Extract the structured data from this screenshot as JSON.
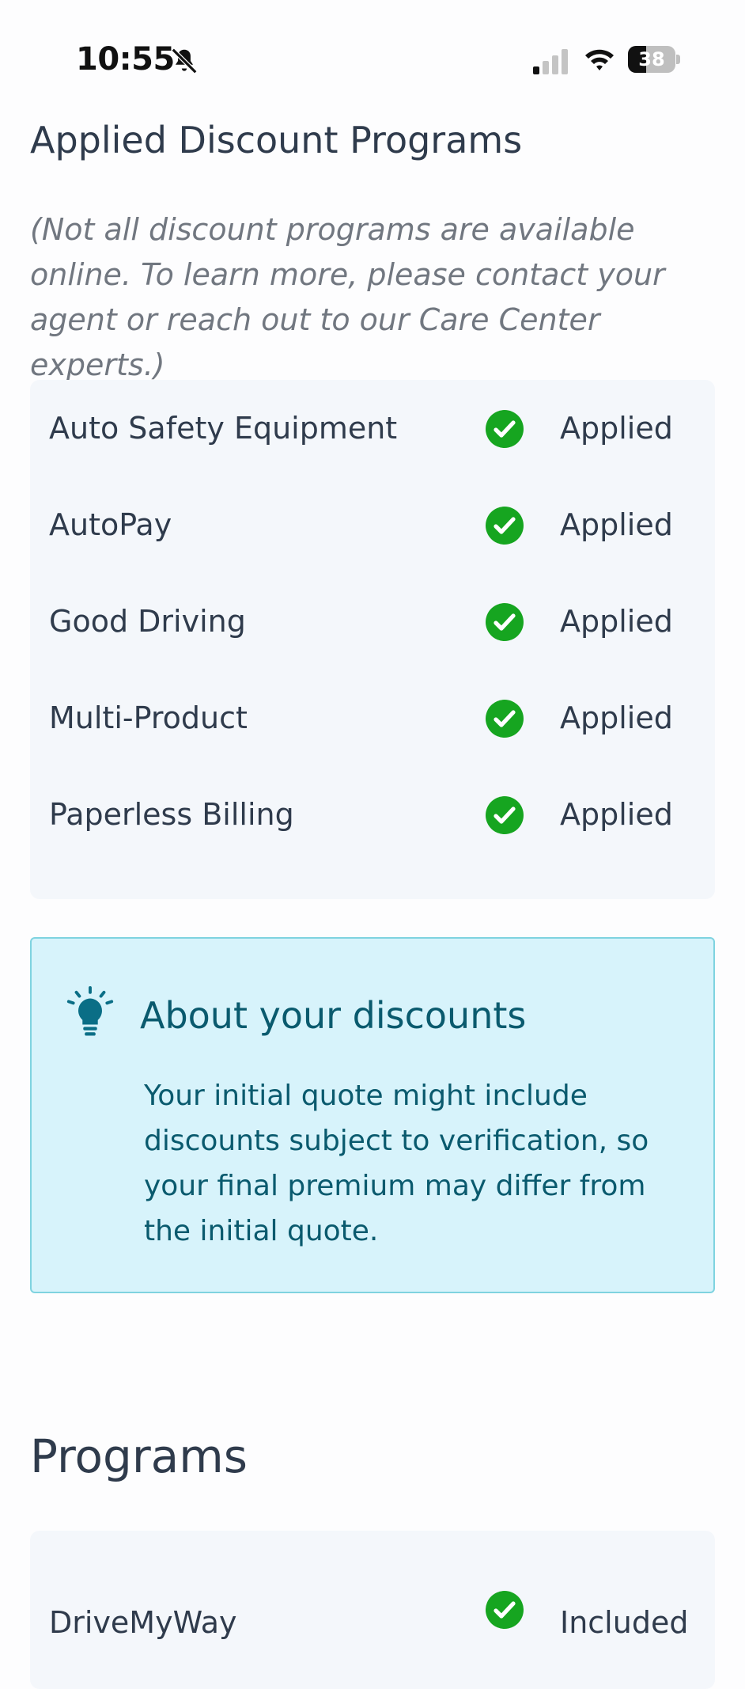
{
  "status_bar": {
    "time": "10:55",
    "battery_percent": "38",
    "battery_level": 0.38
  },
  "discounts": {
    "title": "Applied Discount Programs",
    "note": "(Not all discount programs are available online. To learn more, please contact your agent or reach out to our Care Center experts.)",
    "items": [
      {
        "name": "Auto Safety Equipment",
        "status": "Applied"
      },
      {
        "name": "AutoPay",
        "status": "Applied"
      },
      {
        "name": "Good Driving",
        "status": "Applied"
      },
      {
        "name": "Multi-Product",
        "status": "Applied"
      },
      {
        "name": "Paperless Billing",
        "status": "Applied"
      }
    ]
  },
  "info": {
    "heading": "About your discounts",
    "body": "Your initial quote might include discounts subject to verification, so your final premium may differ from the initial quote.",
    "icon": "lightbulb-icon"
  },
  "programs": {
    "title": "Programs",
    "items": [
      {
        "name": "DriveMyWay",
        "status": "Included"
      }
    ]
  },
  "colors": {
    "check_green": "#16a520",
    "info_bg": "#d7f3fb",
    "info_border": "#7fd3e0",
    "info_text": "#0a5a6e",
    "card_bg": "#f4f7fb"
  }
}
